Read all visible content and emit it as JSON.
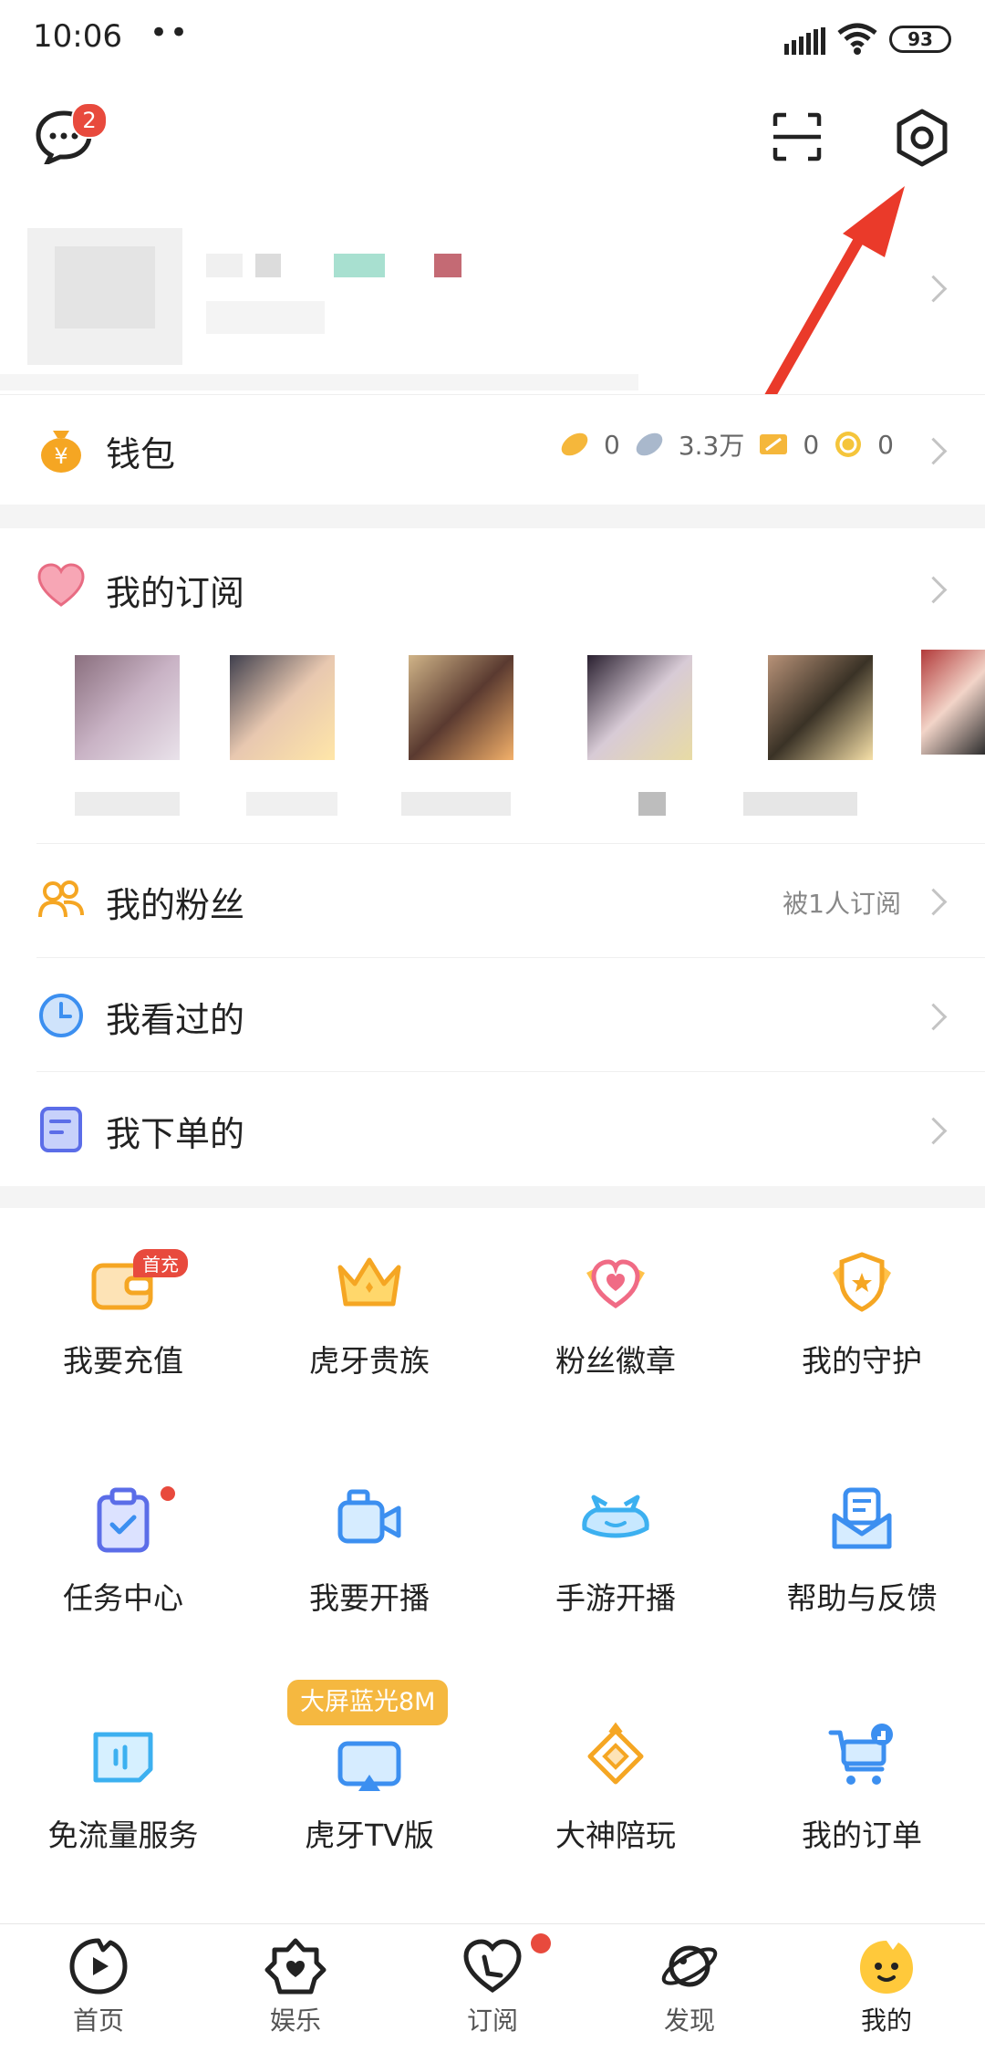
{
  "status_bar": {
    "time": "10:06",
    "dots": "••",
    "battery": "93"
  },
  "header": {
    "message_badge": "2"
  },
  "wallet": {
    "label": "钱包",
    "stats": [
      {
        "icon": "gold-bean-icon",
        "value": "0"
      },
      {
        "icon": "silver-bean-icon",
        "value": "3.3万"
      },
      {
        "icon": "ticket-icon",
        "value": "0"
      },
      {
        "icon": "coin-icon",
        "value": "0"
      }
    ]
  },
  "subscriptions": {
    "label": "我的订阅"
  },
  "menu": [
    {
      "label": "我的粉丝",
      "detail": "被1人订阅",
      "icon": "fans-icon"
    },
    {
      "label": "我看过的",
      "detail": "",
      "icon": "history-clock-icon"
    },
    {
      "label": "我下单的",
      "detail": "",
      "icon": "order-icon"
    }
  ],
  "grid": [
    {
      "label": "我要充值",
      "icon": "wallet-icon",
      "badge": "首充"
    },
    {
      "label": "虎牙贵族",
      "icon": "crown-icon"
    },
    {
      "label": "粉丝徽章",
      "icon": "heart-badge-icon"
    },
    {
      "label": "我的守护",
      "icon": "shield-icon"
    },
    {
      "label": "任务中心",
      "icon": "task-clipboard-icon",
      "dot": true
    },
    {
      "label": "我要开播",
      "icon": "video-camera-icon"
    },
    {
      "label": "手游开播",
      "icon": "game-controller-icon"
    },
    {
      "label": "帮助与反馈",
      "icon": "feedback-mail-icon"
    },
    {
      "label": "免流量服务",
      "icon": "data-card-icon"
    },
    {
      "label": "虎牙TV版",
      "icon": "tv-icon",
      "tooltip": "大屏蓝光8M"
    },
    {
      "label": "大神陪玩",
      "icon": "diamond-icon"
    },
    {
      "label": "我的订单",
      "icon": "shopping-cart-icon"
    }
  ],
  "tabs": [
    {
      "label": "首页",
      "icon": "home-play-icon"
    },
    {
      "label": "娱乐",
      "icon": "entertainment-icon"
    },
    {
      "label": "订阅",
      "icon": "subscribe-heart-icon"
    },
    {
      "label": "发现",
      "icon": "discover-planet-icon"
    },
    {
      "label": "我的",
      "icon": "mine-avatar-icon"
    }
  ],
  "colors": {
    "accent_red": "#e84a3d",
    "orange": "#f5a623",
    "blue": "#3c8ff0",
    "gray_text": "#888888"
  }
}
